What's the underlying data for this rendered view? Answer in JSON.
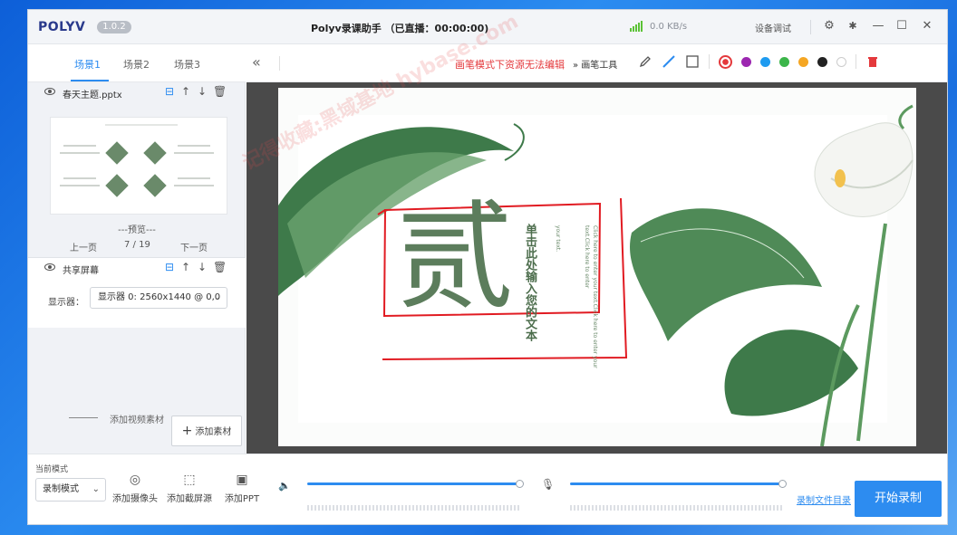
{
  "app": {
    "logo": "POLYV",
    "version": "1.0.2",
    "title": "Polyv录课助手 （已直播：00:00:00)",
    "speed": "0.0 KB/s",
    "device_test": "设备调试"
  },
  "window_buttons": {
    "settings": "⚙",
    "pin": "✱",
    "minimize": "—",
    "maximize": "☐",
    "close": "✕"
  },
  "scenes": [
    {
      "label": "场景1"
    },
    {
      "label": "场景2"
    },
    {
      "label": "场景3"
    }
  ],
  "sources": {
    "ppt": {
      "name": "春天主题.pptx",
      "preview_label": "---预览---",
      "prev": "上一页",
      "page": "7 / 19",
      "next": "下一页"
    },
    "screen": {
      "name": "共享屏幕",
      "display_label": "显示器：",
      "display_value": "显示器 0: 2560x1440 @ 0,0"
    }
  },
  "add_video_label": "添加视频素材",
  "add_material_label": "添加素材",
  "toolbar": {
    "collapse": "«",
    "warning": "画笔模式下资源无法编辑",
    "pen_tools": "» 画笔工具"
  },
  "pen_colors": [
    "#e4393c",
    "#9c27b0",
    "#1e9bf0",
    "#3cb54a",
    "#f5a623",
    "#222222",
    "#ffffff"
  ],
  "slide": {
    "big_char": "贰",
    "vertical_title": "单击此处输入您的文本",
    "body_text_1": "Click here to enter your text.Click here to enter your text.Click here to enter",
    "body_text_2": "your text."
  },
  "watermark": "记得收藏:黑域基地 hybase.com",
  "bottom": {
    "mode_label": "当前模式",
    "mode_value": "录制模式",
    "camera": "添加摄像头",
    "screen": "添加截屏源",
    "ppt": "添加PPT",
    "rec_dir": "录制文件目录",
    "start": "开始录制"
  },
  "audio": {
    "speaker_level": 1.0,
    "mic_level": 1.0
  }
}
